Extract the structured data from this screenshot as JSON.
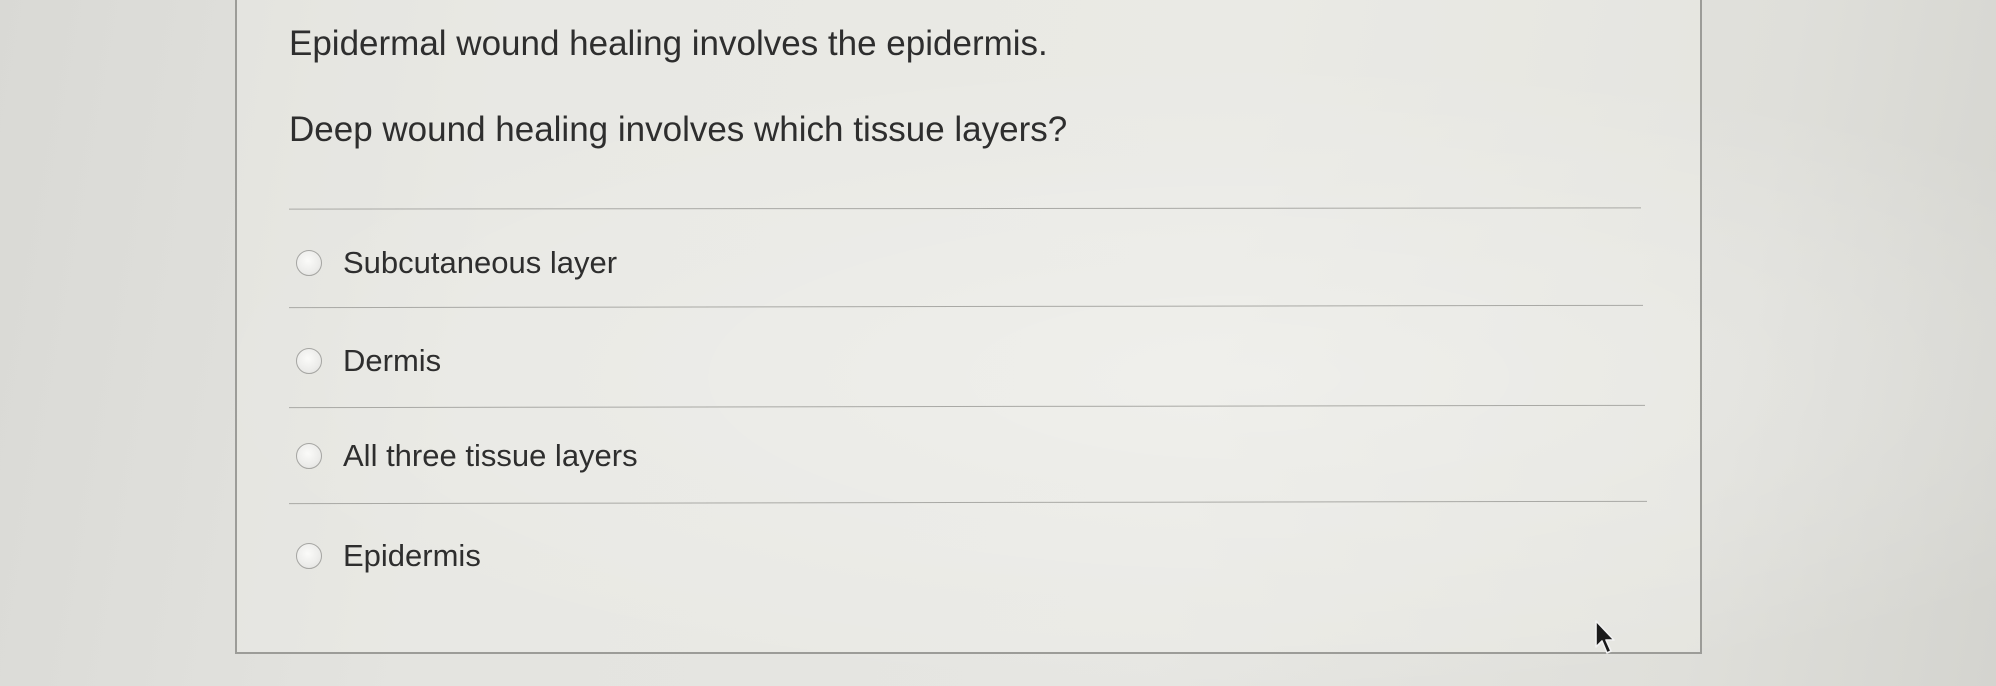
{
  "question": {
    "line1": "Epidermal wound healing involves the epidermis.",
    "line2": "Deep wound healing involves which tissue layers?"
  },
  "choices": [
    {
      "label": "Subcutaneous layer",
      "selected": false
    },
    {
      "label": "Dermis",
      "selected": false
    },
    {
      "label": "All three tissue layers",
      "selected": false
    },
    {
      "label": "Epidermis",
      "selected": false
    }
  ],
  "icons": {
    "radio": "radio-button-icon",
    "cursor": "mouse-pointer-icon"
  }
}
